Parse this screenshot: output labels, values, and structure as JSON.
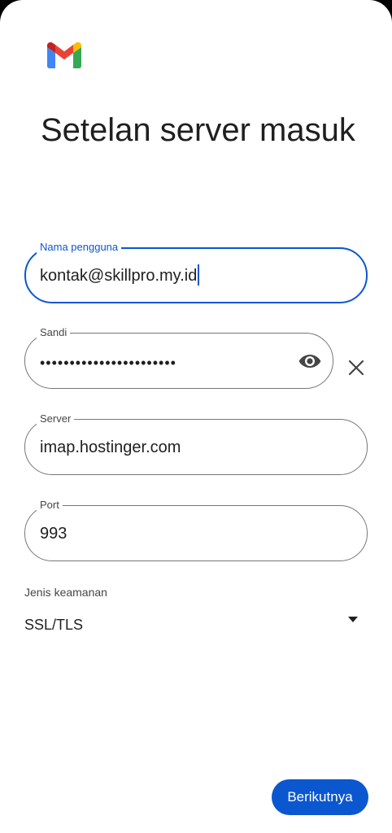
{
  "header": {
    "title": "Setelan server masuk",
    "logo_icon": "gmail-logo-icon"
  },
  "fields": {
    "username": {
      "label": "Nama pengguna",
      "value": "kontak@skillpro.my.id"
    },
    "password": {
      "label": "Sandi",
      "value": "•••••••••••••••••••••••",
      "toggle_icon": "eye-icon",
      "clear_icon": "close-icon"
    },
    "server": {
      "label": "Server",
      "value": "imap.hostinger.com"
    },
    "port": {
      "label": "Port",
      "value": "993"
    }
  },
  "security": {
    "label": "Jenis keamanan",
    "value": "SSL/TLS",
    "arrow_icon": "dropdown-arrow-icon"
  },
  "footer": {
    "next_label": "Berikutnya"
  },
  "colors": {
    "accent": "#0b57d0",
    "text": "#1f1f1f",
    "outline": "#747775",
    "secondary_text": "#444746",
    "background": "#ffffff"
  }
}
